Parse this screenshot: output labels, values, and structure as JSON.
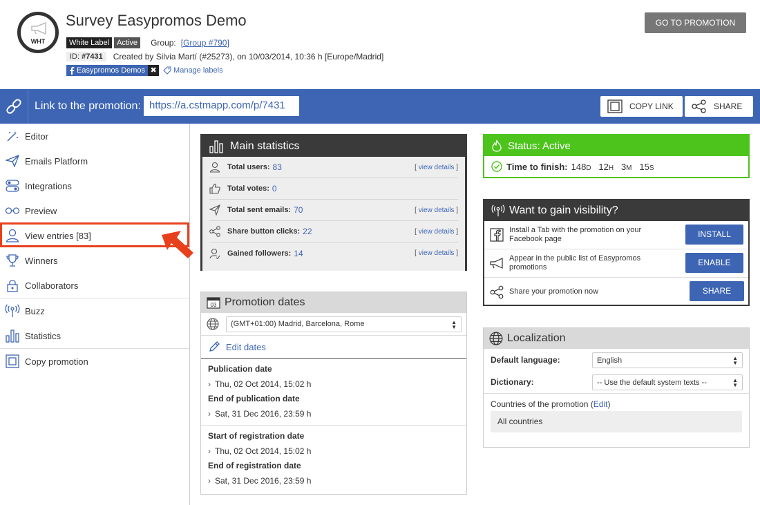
{
  "header": {
    "logo_text": "WHT",
    "title": "Survey Easypromos Demo",
    "badge_white_label": "White Label",
    "badge_active": "Active",
    "group_label": "Group:",
    "group_link": "[Group #790]",
    "id_label": "ID:",
    "id_value": "#7431",
    "created_text": "Created by Silvia Martí (#25273), on 10/03/2014, 10:36 h [Europe/Madrid]",
    "fb_label": "Easypromos Demos",
    "fb_close": "✖",
    "manage_labels": "Manage labels",
    "go_button": "GO TO PROMOTION"
  },
  "linkbar": {
    "label": "Link to the promotion:",
    "url": "https://a.cstmapp.com/p/7431",
    "copy_link": "COPY LINK",
    "share": "SHARE"
  },
  "sidebar": {
    "items": [
      {
        "label": "Editor",
        "icon": "magic-wand-icon"
      },
      {
        "label": "Emails Platform",
        "icon": "paper-plane-icon"
      },
      {
        "label": "Integrations",
        "icon": "toggles-icon"
      },
      {
        "label": "Preview",
        "icon": "glasses-icon"
      },
      {
        "label": "View entries [83]",
        "icon": "user-icon"
      },
      {
        "label": "Winners",
        "icon": "trophy-icon"
      },
      {
        "label": "Collaborators",
        "icon": "lock-icon"
      },
      {
        "label": "Buzz",
        "icon": "broadcast-icon"
      },
      {
        "label": "Statistics",
        "icon": "bar-chart-icon"
      },
      {
        "label": "Copy promotion",
        "icon": "copy-icon"
      }
    ],
    "highlight_color": "#e8401c"
  },
  "main_stats": {
    "title": "Main statistics",
    "view_details": "view details",
    "rows": [
      {
        "label": "Total users:",
        "value": "83",
        "details": true
      },
      {
        "label": "Total votes:",
        "value": "0",
        "details": false
      },
      {
        "label": "Total sent emails:",
        "value": "70",
        "details": true
      },
      {
        "label": "Share button clicks:",
        "value": "22",
        "details": true
      },
      {
        "label": "Gained followers:",
        "value": "14",
        "details": true
      }
    ]
  },
  "dates": {
    "title": "Promotion dates",
    "calendar_day": "03",
    "timezone": "(GMT+01:00) Madrid, Barcelona, Rome",
    "edit_dates": "Edit dates",
    "pub_title": "Publication date",
    "pub_value": "Thu, 02 Oct 2014, 15:02 h",
    "endpub_title": "End of publication date",
    "endpub_value": "Sat, 31 Dec 2016, 23:59 h",
    "startreg_title": "Start of registration date",
    "startreg_value": "Thu, 02 Oct 2014, 15:02 h",
    "endreg_title": "End of registration date",
    "endreg_value": "Sat, 31 Dec 2016, 23:59 h"
  },
  "status": {
    "title": "Status: Active",
    "time_label": "Time to finish:",
    "days": "148",
    "days_unit": "D",
    "hours": "12",
    "hours_unit": "H",
    "minutes": "3",
    "minutes_unit": "M",
    "seconds": "15",
    "seconds_unit": "S",
    "color": "#4cc41c"
  },
  "visibility": {
    "title": "Want to gain visibility?",
    "row1_text": "Install a Tab with the promotion on your Facebook page",
    "row1_button": "INSTALL",
    "row2_text": "Appear in the public list of Easypromos promotions",
    "row2_button": "ENABLE",
    "row3_text": "Share your promotion now",
    "row3_button": "SHARE"
  },
  "localization": {
    "title": "Localization",
    "default_language_label": "Default language:",
    "default_language_value": "English",
    "dictionary_label": "Dictionary:",
    "dictionary_value": "-- Use the default system texts --",
    "countries_label": "Countries of the promotion (",
    "countries_edit": "Edit",
    "countries_close": ")",
    "countries_value": "All countries"
  },
  "colors": {
    "accent_blue": "#3d65b3",
    "dark_header": "#3a3a3a",
    "status_green": "#4cc41c"
  }
}
